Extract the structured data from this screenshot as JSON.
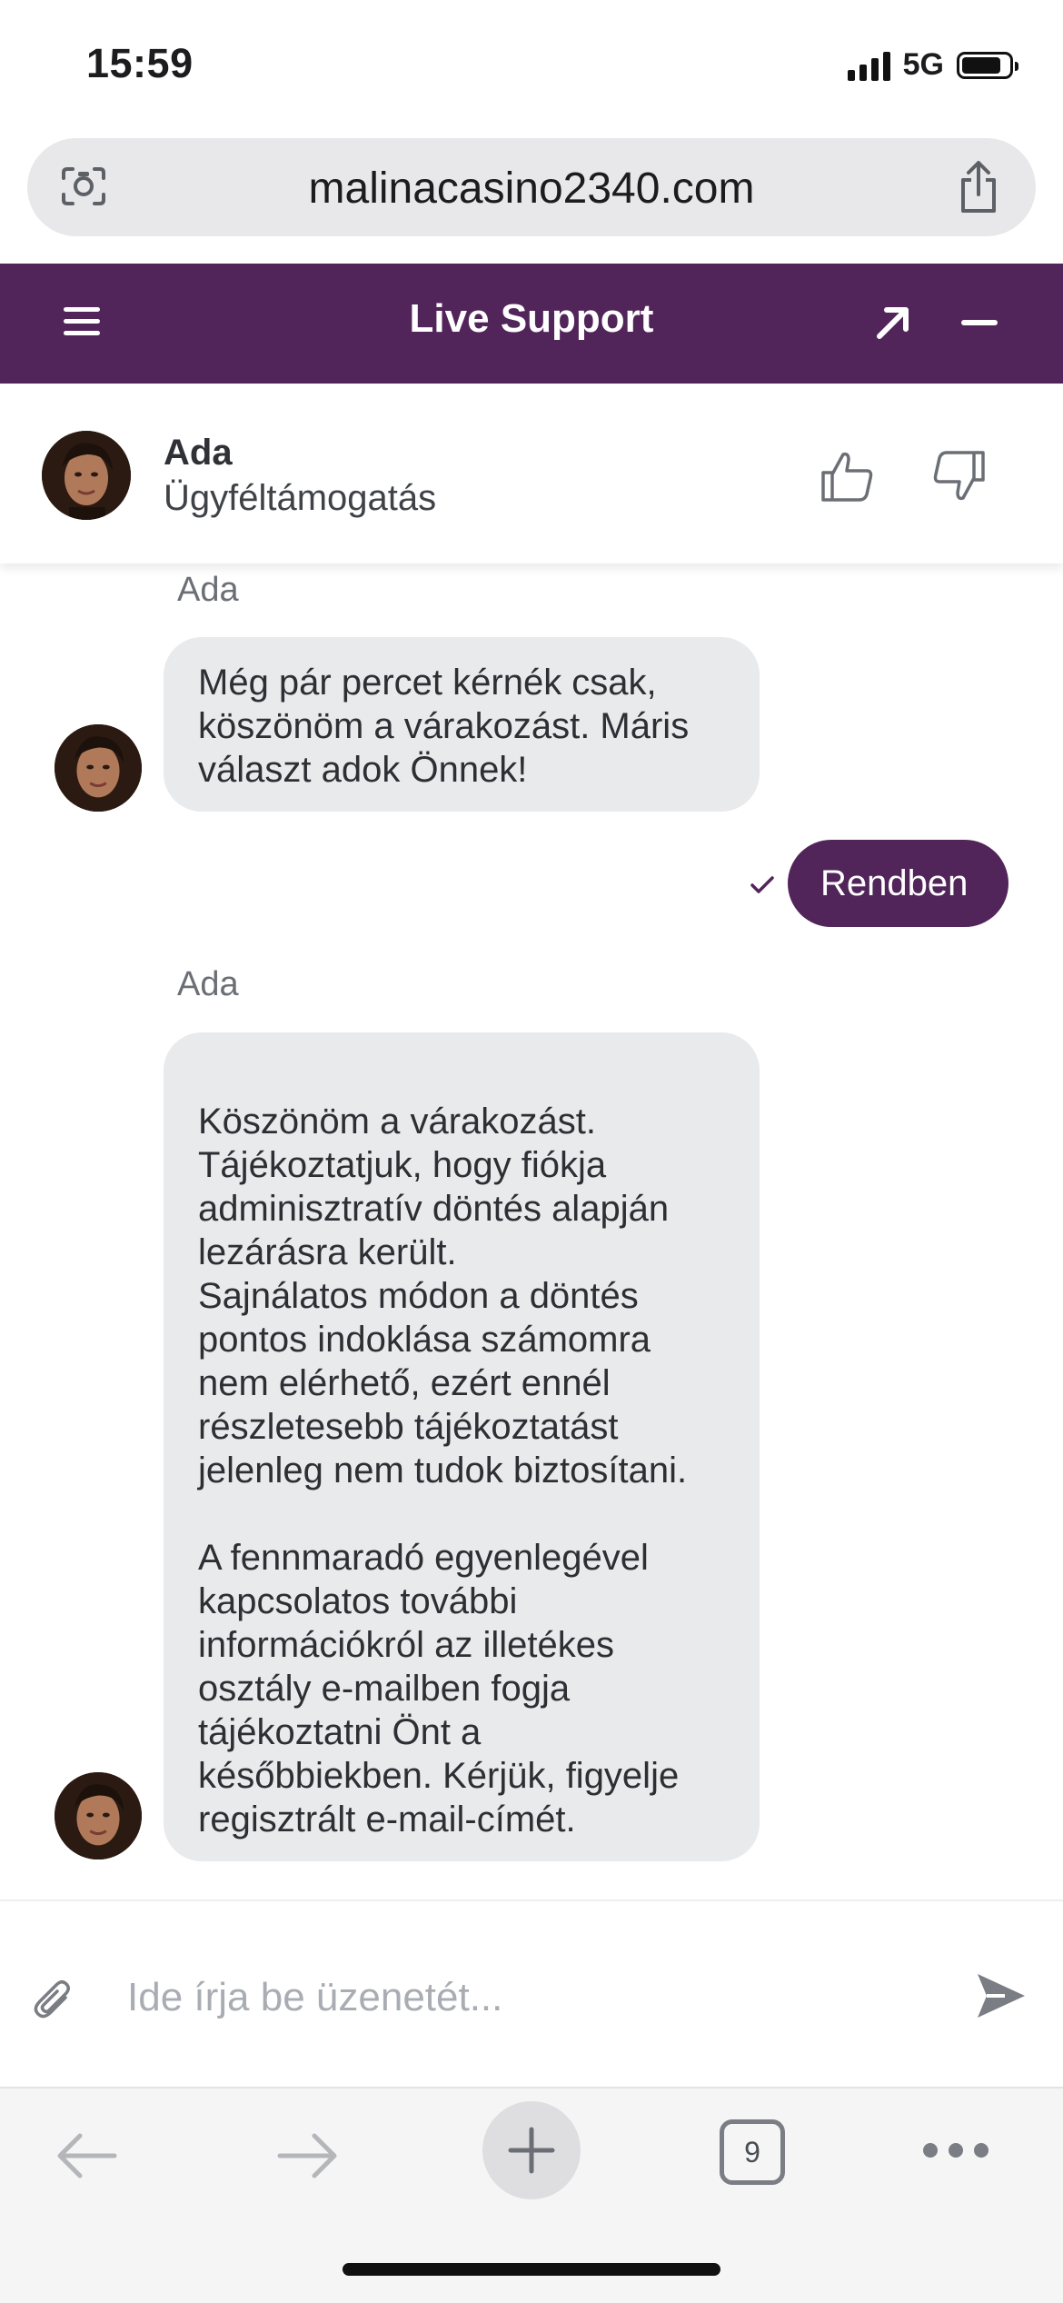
{
  "status_bar": {
    "time": "15:59",
    "network": "5G"
  },
  "browser": {
    "url": "malinacasino2340.com",
    "camera_icon": "camera-scan-icon",
    "share_icon": "share-icon",
    "tab_count": "9"
  },
  "chat_header": {
    "title": "Live Support",
    "accent_color": "#52255a"
  },
  "agent": {
    "name": "Ada",
    "role": "Ügyféltámogatás"
  },
  "messages": [
    {
      "direction": "incoming",
      "sender": "Ada",
      "text": "Még pár percet kérnék csak, köszönöm a várakozást. Máris választ adok Önnek!"
    },
    {
      "direction": "outgoing",
      "text": "Rendben",
      "status": "sent"
    },
    {
      "direction": "incoming",
      "sender": "Ada",
      "text": "Köszönöm a várakozást. Tájékoztatjuk, hogy fiókja adminisztratív döntés alapján lezárásra került.\nSajnálatos módon a döntés pontos indoklása számomra nem elérhető, ezért ennél részletesebb tájékoztatást jelenleg nem tudok biztosítani.\n\nA fennmaradó egyenlegével kapcsolatos további információkról az illetékes osztály e-mailben fogja tájékoztatni Önt a későbbiekben. Kérjük, figyelje regisztrált e-mail-címét."
    }
  ],
  "composer": {
    "placeholder": "Ide írja be üzenetét...",
    "value": ""
  }
}
